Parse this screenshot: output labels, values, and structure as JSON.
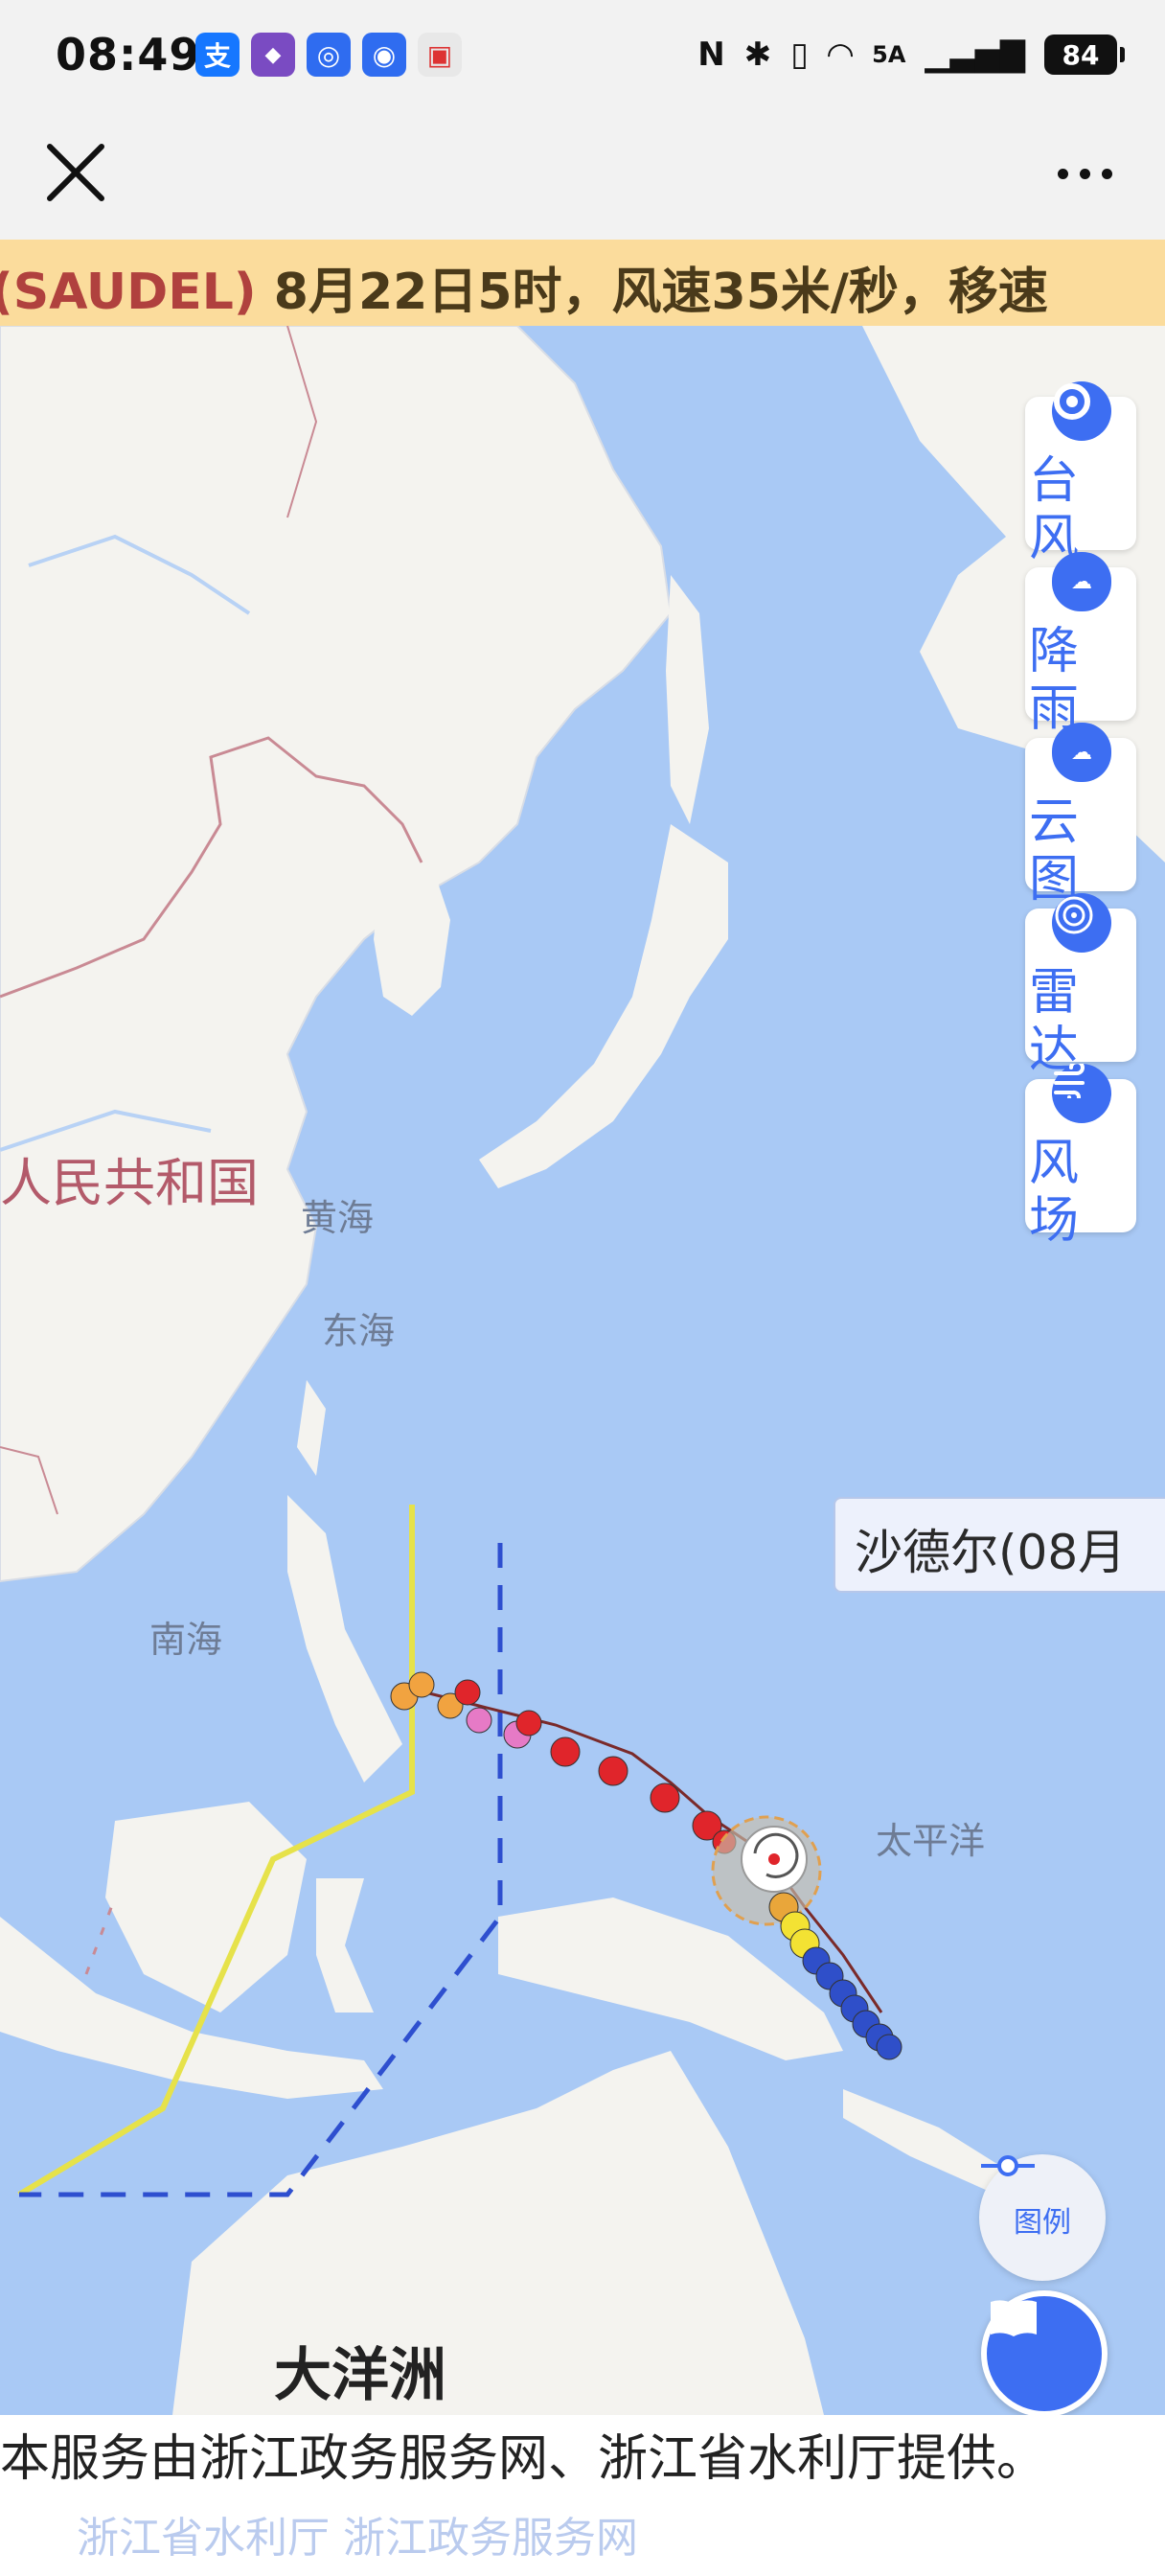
{
  "status_bar": {
    "time": "08:49",
    "app_icons": [
      {
        "name": "alipay-icon",
        "glyph": "支",
        "color": "#1677ff"
      },
      {
        "name": "game-app-icon",
        "glyph": "◆",
        "color": "#7a4bc2"
      },
      {
        "name": "bulb-app-icon",
        "glyph": "◎",
        "color": "#2f6cf0"
      },
      {
        "name": "shield-app-icon",
        "glyph": "◉",
        "color": "#2f6cf0"
      },
      {
        "name": "box-app-icon",
        "glyph": "▣",
        "color": "#e8e8e8"
      }
    ],
    "network": "5A",
    "battery": "84"
  },
  "nav": {
    "close_label": "close",
    "more_label": "more"
  },
  "ticker": {
    "name": "(SAUDEL)",
    "text": "8月22日5时，风速35米/秒，移速"
  },
  "map": {
    "labels": {
      "china": "人民共和国",
      "yellow_sea": "黄海",
      "east_sea": "东海",
      "south_sea": "南海",
      "pacific": "太平洋",
      "oceania": "大洋洲"
    },
    "layers": [
      {
        "id": "typhoon",
        "label": "台风",
        "icon": "typhoon-icon"
      },
      {
        "id": "rain",
        "label": "降雨",
        "icon": "rain-cloud-icon",
        "badge": "雨"
      },
      {
        "id": "cloud",
        "label": "云图",
        "icon": "cloud-icon",
        "badge": "云"
      },
      {
        "id": "radar",
        "label": "雷达",
        "icon": "radar-icon"
      },
      {
        "id": "wind",
        "label": "风场",
        "icon": "wind-icon"
      }
    ],
    "callout": "沙德尔(08月",
    "legend_label": "图例"
  },
  "footer": {
    "text": "本服务由浙江政务服务网、浙江省水利厅提供。",
    "links": "浙江省水利厅   浙江政务服务网"
  },
  "colors": {
    "accent": "#3d6ef2",
    "sea": "#a9c9f5",
    "land": "#f4f3ef",
    "ticker_bg": "#fbdc9c",
    "track_red": "#e0252b",
    "track_blue": "#2f4fc9",
    "track_yellow": "#f3e233"
  }
}
